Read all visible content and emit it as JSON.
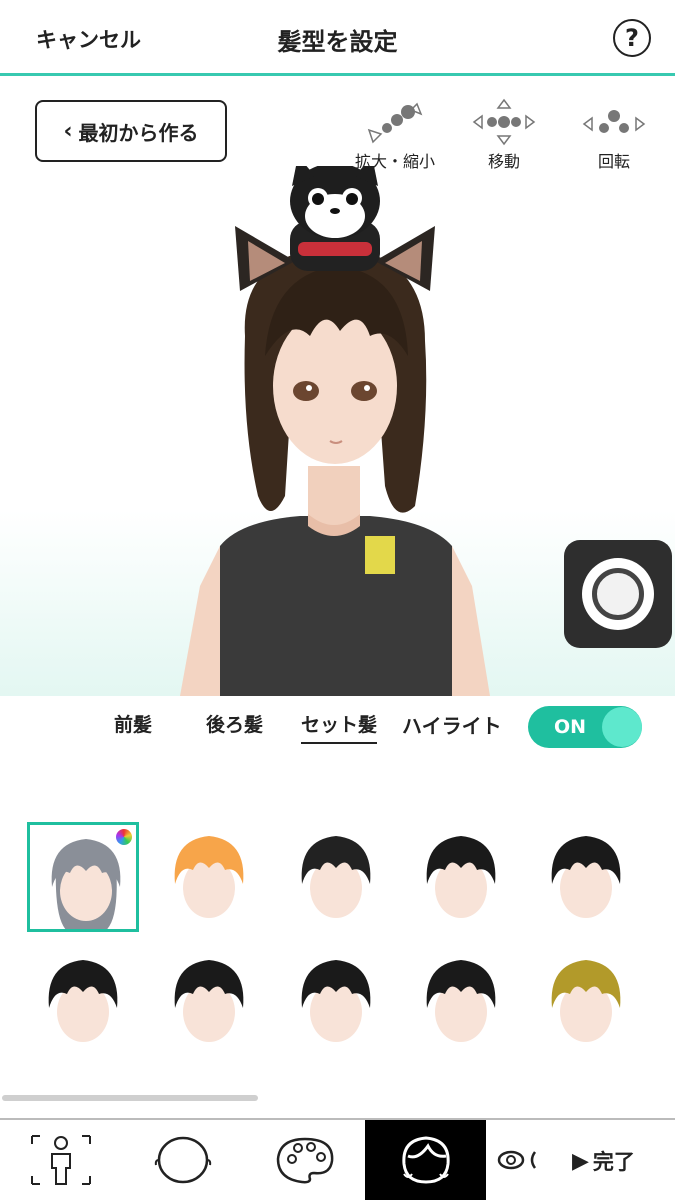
{
  "header": {
    "cancel_label": "キャンセル",
    "title": "髪型を設定",
    "help_label": "?"
  },
  "stage": {
    "restart_label": "最初から作る",
    "controls": [
      {
        "label": "拡大・縮小",
        "icon": "zoom-icon"
      },
      {
        "label": "移動",
        "icon": "move-icon"
      },
      {
        "label": "回転",
        "icon": "rotate-icon"
      }
    ],
    "shutter_icon": "camera-shutter-icon"
  },
  "hair_tabs": {
    "items": [
      "前髪",
      "後ろ髪",
      "セット髪"
    ],
    "selected": "セット髪",
    "highlight_label": "ハイライト",
    "toggle_label": "ON",
    "toggle_on": true
  },
  "hair_grid": {
    "selected_index": 0,
    "row1_colors": [
      "#8a8f98",
      "#f7a54a",
      "#222222",
      "#1a1a1a",
      "#1a1a1a",
      "#1a1a1a"
    ],
    "row2_colors": [
      "#1a1a1a",
      "#1a1a1a",
      "#1a1a1a",
      "#1a1a1a",
      "#b29a2a",
      "#1a1a1a"
    ],
    "accent": "#1fbf9f"
  },
  "bottom_nav": {
    "items": [
      "body-icon",
      "face-icon",
      "palette-icon",
      "hair-icon",
      "eye-icon"
    ],
    "active": "hair-icon",
    "done_label": "完了"
  }
}
